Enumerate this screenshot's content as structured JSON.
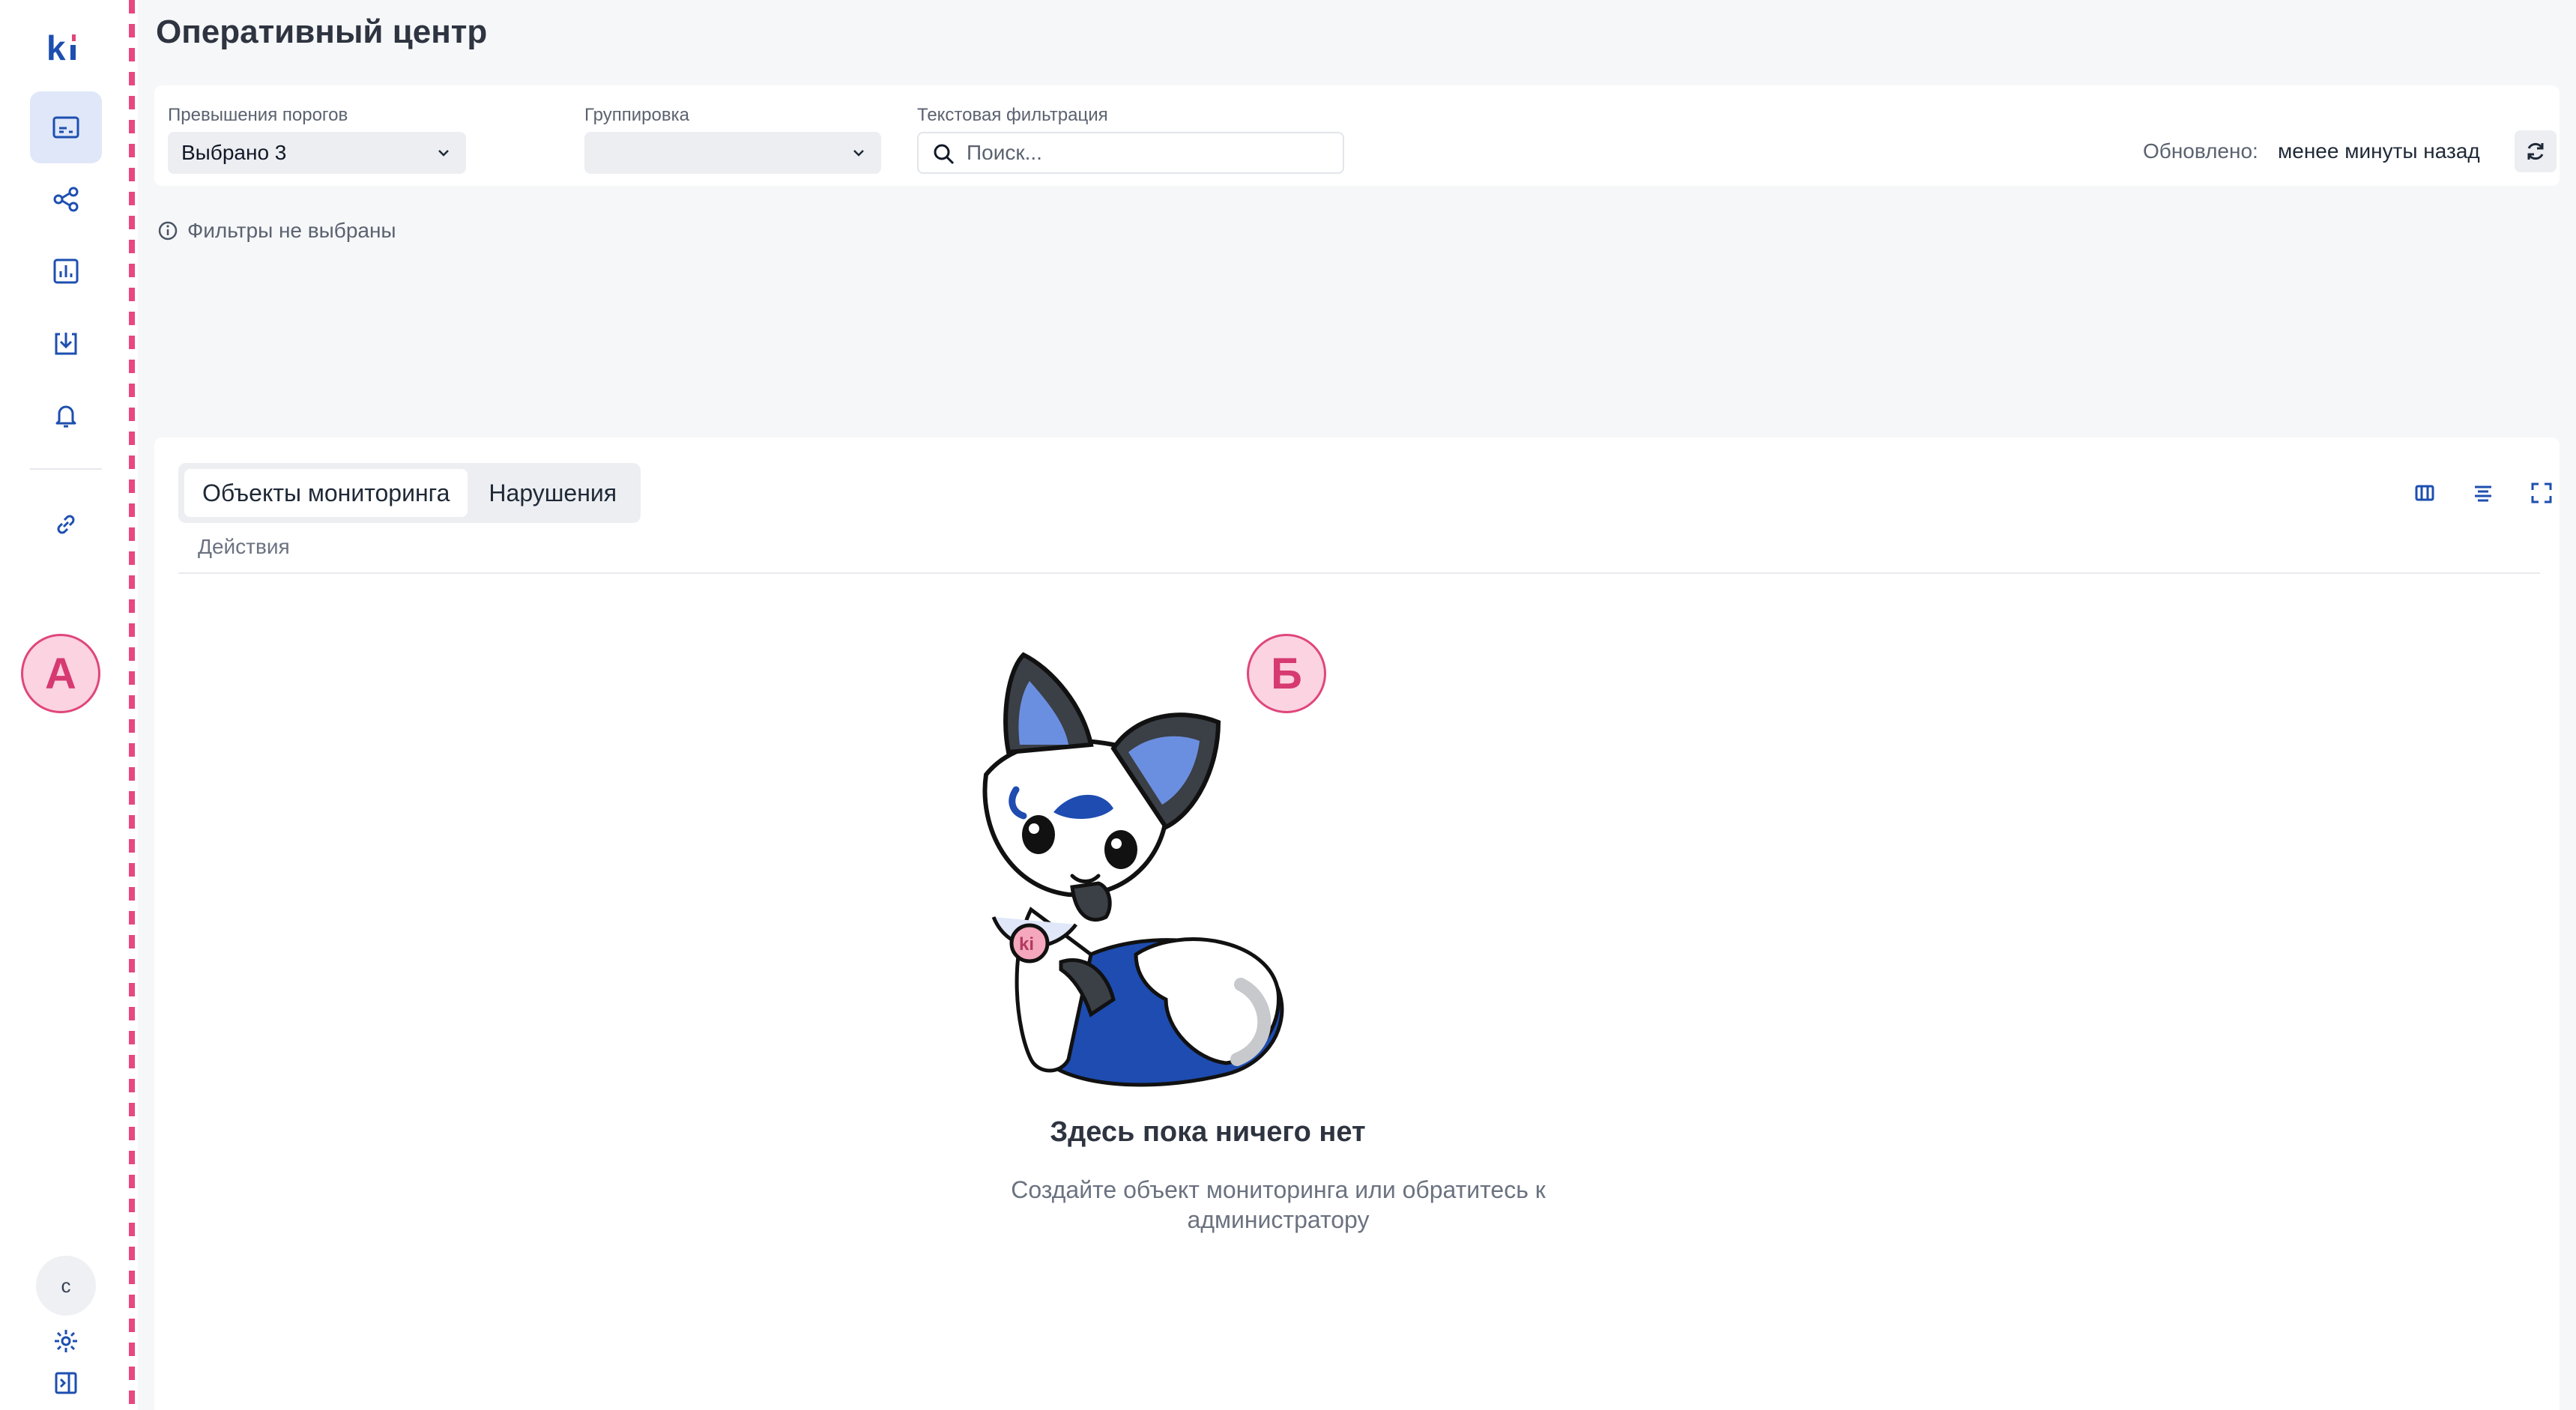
{
  "app": {
    "logo_text": "ki"
  },
  "page": {
    "title": "Оперативный центр"
  },
  "filters": {
    "thresholds": {
      "label": "Превышения порогов",
      "value": "Выбрано 3"
    },
    "grouping": {
      "label": "Группировка",
      "value": ""
    },
    "text_filter": {
      "label": "Текстовая фильтрация",
      "placeholder": "Поиск..."
    },
    "updated_label": "Обновлено:",
    "updated_value": "менее минуты назад",
    "no_filters_text": "Фильтры не выбраны"
  },
  "tabs": [
    {
      "label": "Объекты мониторинга",
      "active": true
    },
    {
      "label": "Нарушения",
      "active": false
    }
  ],
  "actions_label": "Действия",
  "empty_state": {
    "title": "Здесь пока ничего нет",
    "text": "Создайте объект мониторинга или обратитесь к администратору"
  },
  "user": {
    "avatar_letter": "c"
  },
  "markers": {
    "a": "А",
    "b": "Б"
  },
  "colors": {
    "accent": "#1d4fb0",
    "marker": "#e0467c",
    "active_bg": "#dfe7f8"
  },
  "icons": [
    "dashboard-icon",
    "topology-icon",
    "chart-icon",
    "import-icon",
    "bell-icon",
    "link-icon",
    "settings-icon",
    "collapse-sidebar-icon",
    "columns-icon",
    "align-icon",
    "fullscreen-icon",
    "refresh-icon",
    "search-icon",
    "info-icon",
    "chevron-down-icon"
  ]
}
